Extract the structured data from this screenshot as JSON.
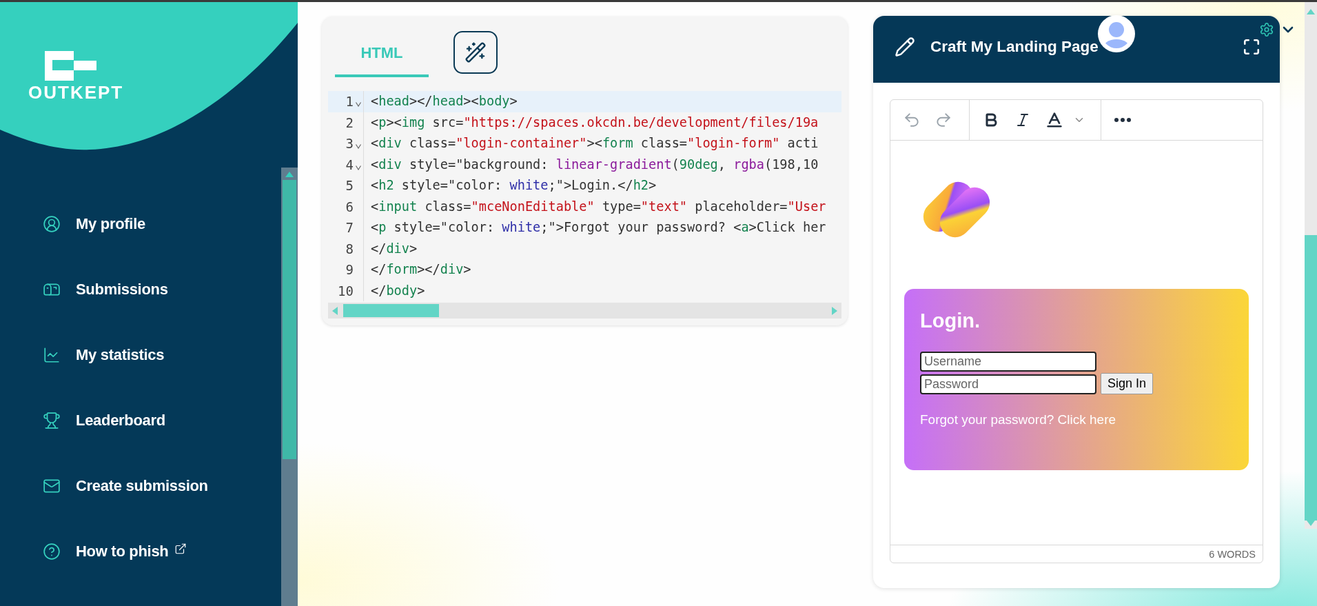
{
  "sidebar": {
    "logo_text": "OUTKEPT",
    "items": [
      {
        "label": "My profile",
        "external": false
      },
      {
        "label": "Submissions",
        "external": false
      },
      {
        "label": "My statistics",
        "external": false
      },
      {
        "label": "Leaderboard",
        "external": false
      },
      {
        "label": "Create submission",
        "external": false
      },
      {
        "label": "How to phish",
        "external": true
      }
    ]
  },
  "editor": {
    "tabs": [
      {
        "label": "HTML",
        "selected": true
      }
    ],
    "lines": [
      {
        "number": "1",
        "foldable": true,
        "active": true,
        "tokens": [
          {
            "kind": "p",
            "text": "<"
          },
          {
            "kind": "t",
            "text": "head"
          },
          {
            "kind": "p",
            "text": "></"
          },
          {
            "kind": "t",
            "text": "head"
          },
          {
            "kind": "p",
            "text": "><"
          },
          {
            "kind": "t",
            "text": "body"
          },
          {
            "kind": "p",
            "text": ">"
          }
        ]
      },
      {
        "number": "2",
        "foldable": false,
        "active": false,
        "tokens": [
          {
            "kind": "p",
            "text": "<"
          },
          {
            "kind": "t",
            "text": "p"
          },
          {
            "kind": "p",
            "text": "><"
          },
          {
            "kind": "t",
            "text": "img"
          },
          {
            "kind": "p",
            "text": " src="
          },
          {
            "kind": "s",
            "text": "\"https://spaces.okcdn.be/development/files/19a"
          }
        ]
      },
      {
        "number": "3",
        "foldable": true,
        "active": false,
        "tokens": [
          {
            "kind": "p",
            "text": "<"
          },
          {
            "kind": "t",
            "text": "div"
          },
          {
            "kind": "p",
            "text": " class="
          },
          {
            "kind": "s",
            "text": "\"login-container\""
          },
          {
            "kind": "p",
            "text": "><"
          },
          {
            "kind": "t",
            "text": "form"
          },
          {
            "kind": "p",
            "text": " class="
          },
          {
            "kind": "s",
            "text": "\"login-form\""
          },
          {
            "kind": "p",
            "text": " acti"
          }
        ]
      },
      {
        "number": "4",
        "foldable": true,
        "active": false,
        "tokens": [
          {
            "kind": "p",
            "text": "<"
          },
          {
            "kind": "t",
            "text": "div"
          },
          {
            "kind": "p",
            "text": " style=\"background: "
          },
          {
            "kind": "f",
            "text": "linear-gradient"
          },
          {
            "kind": "p",
            "text": "("
          },
          {
            "kind": "n",
            "text": "90deg"
          },
          {
            "kind": "p",
            "text": ", "
          },
          {
            "kind": "f",
            "text": "rgba"
          },
          {
            "kind": "p",
            "text": "(198,10"
          }
        ]
      },
      {
        "number": "5",
        "foldable": false,
        "active": false,
        "tokens": [
          {
            "kind": "p",
            "text": "<"
          },
          {
            "kind": "t",
            "text": "h2"
          },
          {
            "kind": "p",
            "text": " style=\"color: "
          },
          {
            "kind": "k",
            "text": "white"
          },
          {
            "kind": "p",
            "text": ";\">Login.</"
          },
          {
            "kind": "t",
            "text": "h2"
          },
          {
            "kind": "p",
            "text": ">"
          }
        ]
      },
      {
        "number": "6",
        "foldable": false,
        "active": false,
        "tokens": [
          {
            "kind": "p",
            "text": "<"
          },
          {
            "kind": "t",
            "text": "input"
          },
          {
            "kind": "p",
            "text": " class="
          },
          {
            "kind": "s",
            "text": "\"mceNonEditable\""
          },
          {
            "kind": "p",
            "text": " type="
          },
          {
            "kind": "s",
            "text": "\"text\""
          },
          {
            "kind": "p",
            "text": " placeholder="
          },
          {
            "kind": "s",
            "text": "\"User"
          }
        ]
      },
      {
        "number": "7",
        "foldable": false,
        "active": false,
        "tokens": [
          {
            "kind": "p",
            "text": "<"
          },
          {
            "kind": "t",
            "text": "p"
          },
          {
            "kind": "p",
            "text": " style=\"color: "
          },
          {
            "kind": "k",
            "text": "white"
          },
          {
            "kind": "p",
            "text": ";\">Forgot your password? <"
          },
          {
            "kind": "t",
            "text": "a"
          },
          {
            "kind": "p",
            "text": ">Click her"
          }
        ]
      },
      {
        "number": "8",
        "foldable": false,
        "active": false,
        "tokens": [
          {
            "kind": "p",
            "text": "</"
          },
          {
            "kind": "t",
            "text": "div"
          },
          {
            "kind": "p",
            "text": ">"
          }
        ]
      },
      {
        "number": "9",
        "foldable": false,
        "active": false,
        "tokens": [
          {
            "kind": "p",
            "text": "</"
          },
          {
            "kind": "t",
            "text": "form"
          },
          {
            "kind": "p",
            "text": "></"
          },
          {
            "kind": "t",
            "text": "div"
          },
          {
            "kind": "p",
            "text": ">"
          }
        ]
      },
      {
        "number": "10",
        "foldable": false,
        "active": false,
        "tokens": [
          {
            "kind": "p",
            "text": "</"
          },
          {
            "kind": "t",
            "text": "body"
          },
          {
            "kind": "p",
            "text": ">"
          }
        ]
      }
    ]
  },
  "preview": {
    "title": "Craft My Landing Page",
    "login": {
      "heading": "Login.",
      "username_placeholder": "Username",
      "password_placeholder": "Password",
      "button": "Sign In",
      "forgot": "Forgot your password? Click here"
    },
    "word_count": "6 WORDS"
  }
}
